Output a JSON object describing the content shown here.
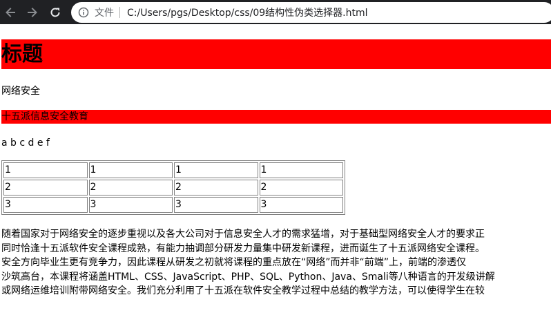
{
  "browser": {
    "omnibox_label": "文件",
    "url": "C:/Users/pgs/Desktop/css/09结构性伪类选择器.html"
  },
  "page": {
    "heading": "标题",
    "p1": "网络安全",
    "p2": "十五派信息安全教育",
    "p3": "a b c d e f",
    "table": [
      [
        "1",
        "1",
        "1",
        "1"
      ],
      [
        "2",
        "2",
        "2",
        "2"
      ],
      [
        "3",
        "3",
        "3",
        "3"
      ]
    ],
    "paragraph_lines": [
      "随着国家对于网络安全的逐步重视以及各大公司对于信息安全人才的需求猛增，对于基础型网络安全人才的要求正",
      "同时恰逢十五派软件安全课程成熟，有能力抽调部分研发力量集中研发新课程，进而诞生了十五派网络安全课程。",
      "安全方向毕业生更有竞争力，因此课程从研发之初就将课程的重点放在“网络”而并非“前端”上，前端的渗透仅",
      "沙筑高台，本课程将涵盖HTML、CSS、JavaScript、PHP、SQL、Python、Java、Smali等八种语言的开发级讲解",
      "或网络运维培训附带网络安全。我们充分利用了十五派在软件安全教学过程中总结的教学方法，可以使得学生在较"
    ]
  },
  "colors": {
    "highlight": "#ff0000",
    "chrome_bg": "#202124"
  },
  "icons": {
    "back": "arrow-left-icon",
    "forward": "arrow-right-icon",
    "reload": "reload-icon",
    "info": "info-icon"
  }
}
